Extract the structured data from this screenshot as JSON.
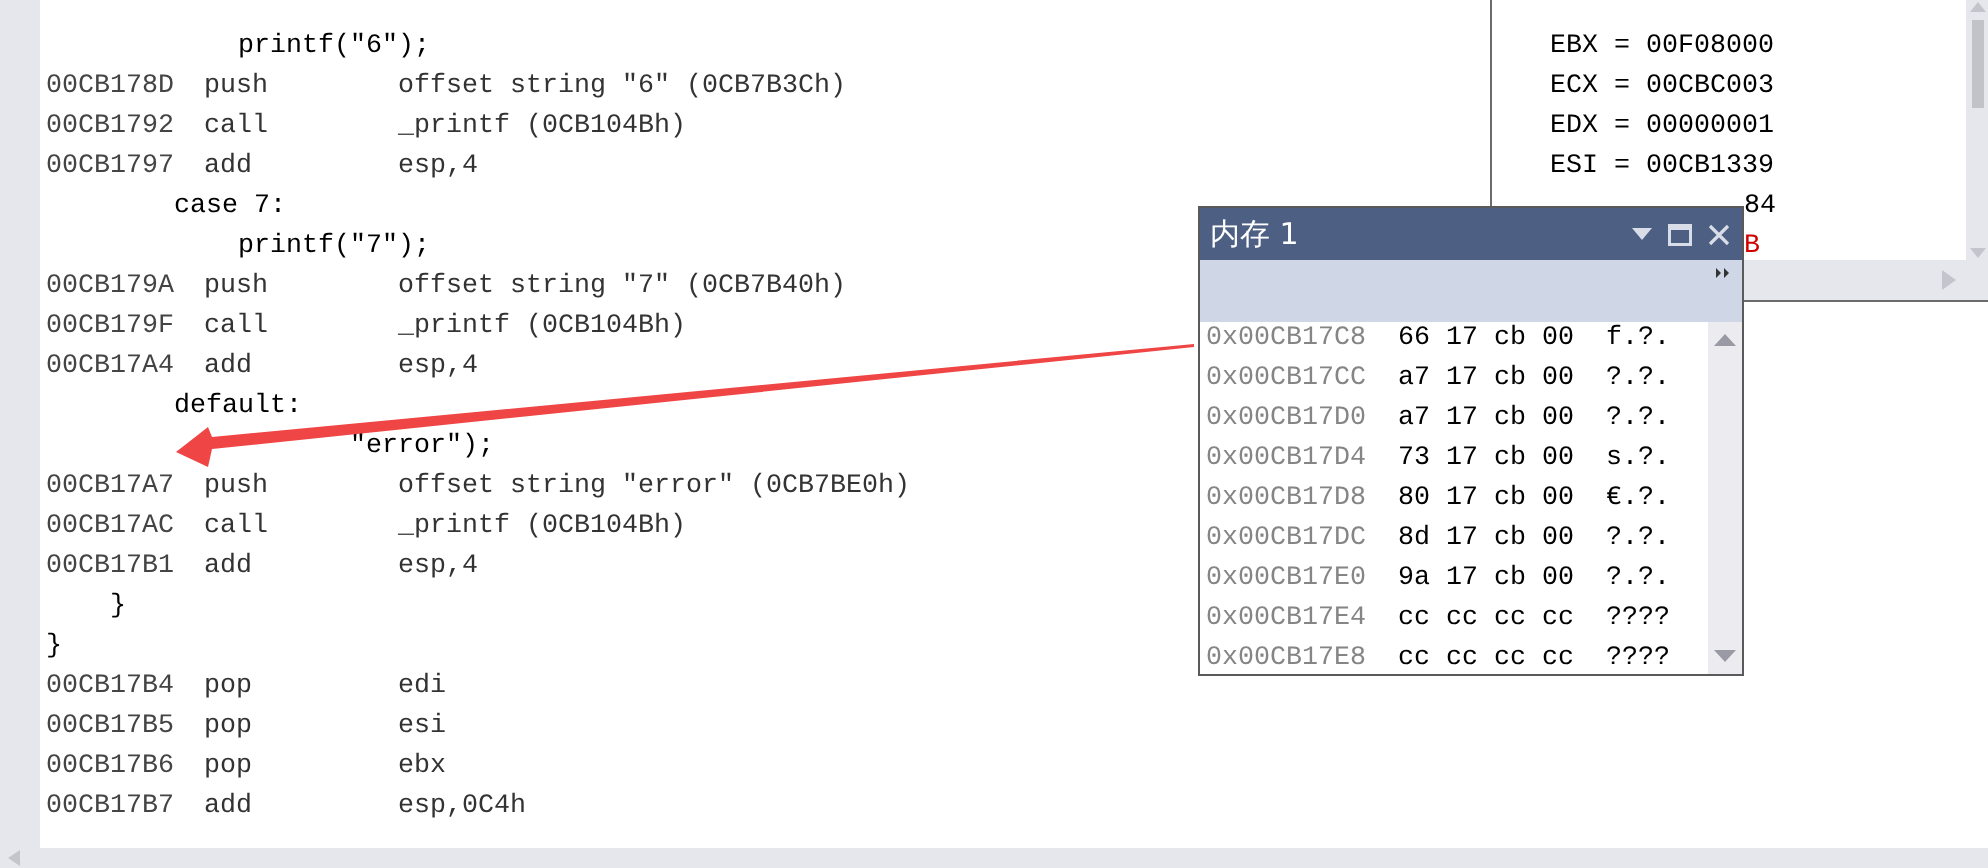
{
  "code_lines": [
    {
      "kind": "source",
      "text": "            printf(\"6\");"
    },
    {
      "kind": "asm",
      "address": "00CB178D",
      "mnemonic": "push",
      "operand": "offset string \"6\" (0CB7B3Ch)"
    },
    {
      "kind": "asm",
      "address": "00CB1792",
      "mnemonic": "call",
      "operand": "_printf (0CB104Bh)"
    },
    {
      "kind": "asm",
      "address": "00CB1797",
      "mnemonic": "add",
      "operand": "esp,4"
    },
    {
      "kind": "source",
      "text": "        case 7:"
    },
    {
      "kind": "source",
      "text": "            printf(\"7\");"
    },
    {
      "kind": "asm",
      "address": "00CB179A",
      "mnemonic": "push",
      "operand": "offset string \"7\" (0CB7B40h)"
    },
    {
      "kind": "asm",
      "address": "00CB179F",
      "mnemonic": "call",
      "operand": "_printf (0CB104Bh)"
    },
    {
      "kind": "asm",
      "address": "00CB17A4",
      "mnemonic": "add",
      "operand": "esp,4"
    },
    {
      "kind": "source",
      "text": "        default:"
    },
    {
      "kind": "source",
      "text": "                   \"error\");"
    },
    {
      "kind": "asm",
      "address": "00CB17A7",
      "mnemonic": "push",
      "operand": "offset string \"error\" (0CB7BE0h)"
    },
    {
      "kind": "asm",
      "address": "00CB17AC",
      "mnemonic": "call",
      "operand": "_printf (0CB104Bh)"
    },
    {
      "kind": "asm",
      "address": "00CB17B1",
      "mnemonic": "add",
      "operand": "esp,4"
    },
    {
      "kind": "source",
      "text": "    }"
    },
    {
      "kind": "source",
      "text": "}"
    },
    {
      "kind": "asm",
      "address": "00CB17B4",
      "mnemonic": "pop",
      "operand": "edi"
    },
    {
      "kind": "asm",
      "address": "00CB17B5",
      "mnemonic": "pop",
      "operand": "esi"
    },
    {
      "kind": "asm",
      "address": "00CB17B6",
      "mnemonic": "pop",
      "operand": "ebx"
    },
    {
      "kind": "asm",
      "address": "00CB17B7",
      "mnemonic": "add",
      "operand": "esp,0C4h"
    }
  ],
  "registers": [
    {
      "kind": "full",
      "text": "EBX = 00F08000",
      "changed": false
    },
    {
      "kind": "full",
      "text": "ECX = 00CBC003",
      "changed": false
    },
    {
      "kind": "full",
      "text": "EDX = 00000001",
      "changed": false
    },
    {
      "kind": "full",
      "text": "ESI = 00CB1339",
      "changed": false
    },
    {
      "kind": "partial",
      "text": "84",
      "changed": false
    },
    {
      "kind": "partial",
      "text": "B",
      "changed": true
    }
  ],
  "memory_window": {
    "title": "内存 1",
    "rows": [
      {
        "address": "0x00CB17C8",
        "bytes": "66 17 cb 00",
        "ascii": "f.?."
      },
      {
        "address": "0x00CB17CC",
        "bytes": "a7 17 cb 00",
        "ascii": "?.?."
      },
      {
        "address": "0x00CB17D0",
        "bytes": "a7 17 cb 00",
        "ascii": "?.?."
      },
      {
        "address": "0x00CB17D4",
        "bytes": "73 17 cb 00",
        "ascii": "s.?."
      },
      {
        "address": "0x00CB17D8",
        "bytes": "80 17 cb 00",
        "ascii": "€.?."
      },
      {
        "address": "0x00CB17DC",
        "bytes": "8d 17 cb 00",
        "ascii": "?.?."
      },
      {
        "address": "0x00CB17E0",
        "bytes": "9a 17 cb 00",
        "ascii": "?.?."
      },
      {
        "address": "0x00CB17E4",
        "bytes": "cc cc cc cc",
        "ascii": "????"
      },
      {
        "address": "0x00CB17E8",
        "bytes": "cc cc cc cc",
        "ascii": "????"
      }
    ]
  }
}
